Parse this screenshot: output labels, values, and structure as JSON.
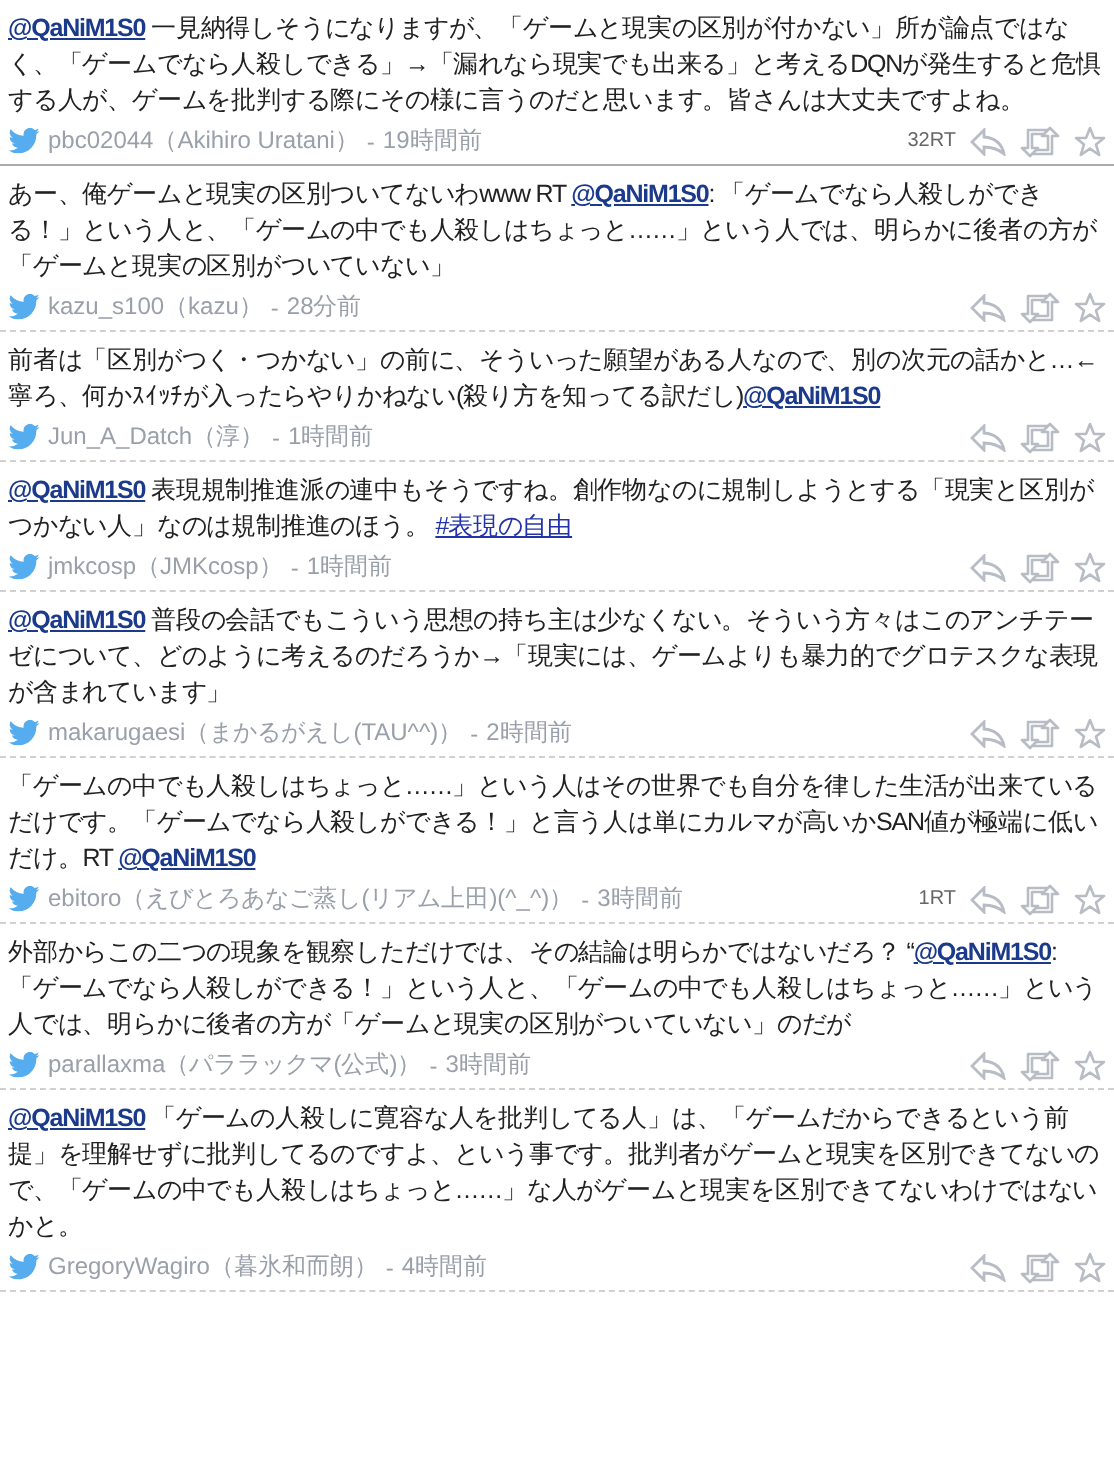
{
  "tweets": [
    {
      "body": [
        {
          "kind": "mention",
          "text": "@QaNiM1S0"
        },
        {
          "kind": "text",
          "text": " 一見納得しそうになりますが、「ゲームと現実の区別が付かない」所が論点ではなく、「ゲームでなら人殺しできる」→「漏れなら現実でも出来る」と考えるDQNが発生すると危惧する人が、ゲームを批判する際にその様に言うのだと思います。皆さんは大丈夫ですよね。"
        }
      ],
      "user": "pbc02044（Akihiro Uratani）",
      "separator": "-",
      "time": "19時間前",
      "rt_count": "32RT"
    },
    {
      "body": [
        {
          "kind": "text",
          "text": "あー、俺ゲームと現実の区別ついてないわwww RT "
        },
        {
          "kind": "mention",
          "text": "@QaNiM1S0"
        },
        {
          "kind": "text",
          "text": ": 「ゲームでなら人殺しができる！」という人と、「ゲームの中でも人殺しはちょっと……」という人では、明らかに後者の方が「ゲームと現実の区別がついていない」"
        }
      ],
      "user": "kazu_s100（kazu）",
      "separator": "-",
      "time": "28分前"
    },
    {
      "body": [
        {
          "kind": "text",
          "text": "前者は「区別がつく・つかない」の前に、そういった願望がある人なので、別の次元の話かと…←寧ろ、何かｽｲｯﾁが入ったらやりかねない(殺り方を知ってる訳だし)"
        },
        {
          "kind": "mention",
          "text": "@QaNiM1S0"
        }
      ],
      "user": "Jun_A_Datch（淳）",
      "separator": "-",
      "time": "1時間前"
    },
    {
      "body": [
        {
          "kind": "mention",
          "text": "@QaNiM1S0"
        },
        {
          "kind": "text",
          "text": " 表現規制推進派の連中もそうですね。創作物なのに規制しようとする「現実と区別がつかない人」なのは規制推進のほう。 "
        },
        {
          "kind": "hashtag",
          "text": "#表現の自由"
        }
      ],
      "user": "jmkcosp（JMKcosp）",
      "separator": "-",
      "time": "1時間前"
    },
    {
      "body": [
        {
          "kind": "mention",
          "text": "@QaNiM1S0"
        },
        {
          "kind": "text",
          "text": " 普段の会話でもこういう思想の持ち主は少なくない。そういう方々はこのアンチテーゼについて、どのように考えるのだろうか→「現実には、ゲームよりも暴力的でグロテスクな表現が含まれています」"
        }
      ],
      "user": "makarugaesi（まかるがえし(TAU^^)）",
      "separator": "-",
      "time": "2時間前"
    },
    {
      "body": [
        {
          "kind": "text",
          "text": "「ゲームの中でも人殺しはちょっと……」という人はその世界でも自分を律した生活が出来ているだけです。「ゲームでなら人殺しができる！」と言う人は単にカルマが高いかSAN値が極端に低いだけ。RT "
        },
        {
          "kind": "mention",
          "text": "@QaNiM1S0"
        }
      ],
      "user": "ebitoro（えびとろあなご蒸し(リアム上田)(^_^)）",
      "separator": "-",
      "time": "3時間前",
      "rt_count": "1RT"
    },
    {
      "body": [
        {
          "kind": "text",
          "text": "外部からこの二つの現象を観察しただけでは、その結論は明らかではないだろ？ “"
        },
        {
          "kind": "mention",
          "text": "@QaNiM1S0"
        },
        {
          "kind": "text",
          "text": ": 「ゲームでなら人殺しができる！」という人と、「ゲームの中でも人殺しはちょっと……」という人では、明らかに後者の方が「ゲームと現実の区別がついていない」のだが"
        }
      ],
      "user": "parallaxma（パララックマ(公式)）",
      "separator": "-",
      "time": "3時間前"
    },
    {
      "body": [
        {
          "kind": "mention",
          "text": "@QaNiM1S0"
        },
        {
          "kind": "text",
          "text": " 「ゲームの人殺しに寛容な人を批判してる人」は、「ゲームだからできるという前提」を理解せずに批判してるのですよ、という事です。批判者がゲームと現実を区別できてないので、「ゲームの中でも人殺しはちょっと……」な人がゲームと現実を区別できてないわけではないかと。"
        }
      ],
      "user": "GregoryWagiro（暮氷和而朗）",
      "separator": "-",
      "time": "4時間前"
    }
  ]
}
